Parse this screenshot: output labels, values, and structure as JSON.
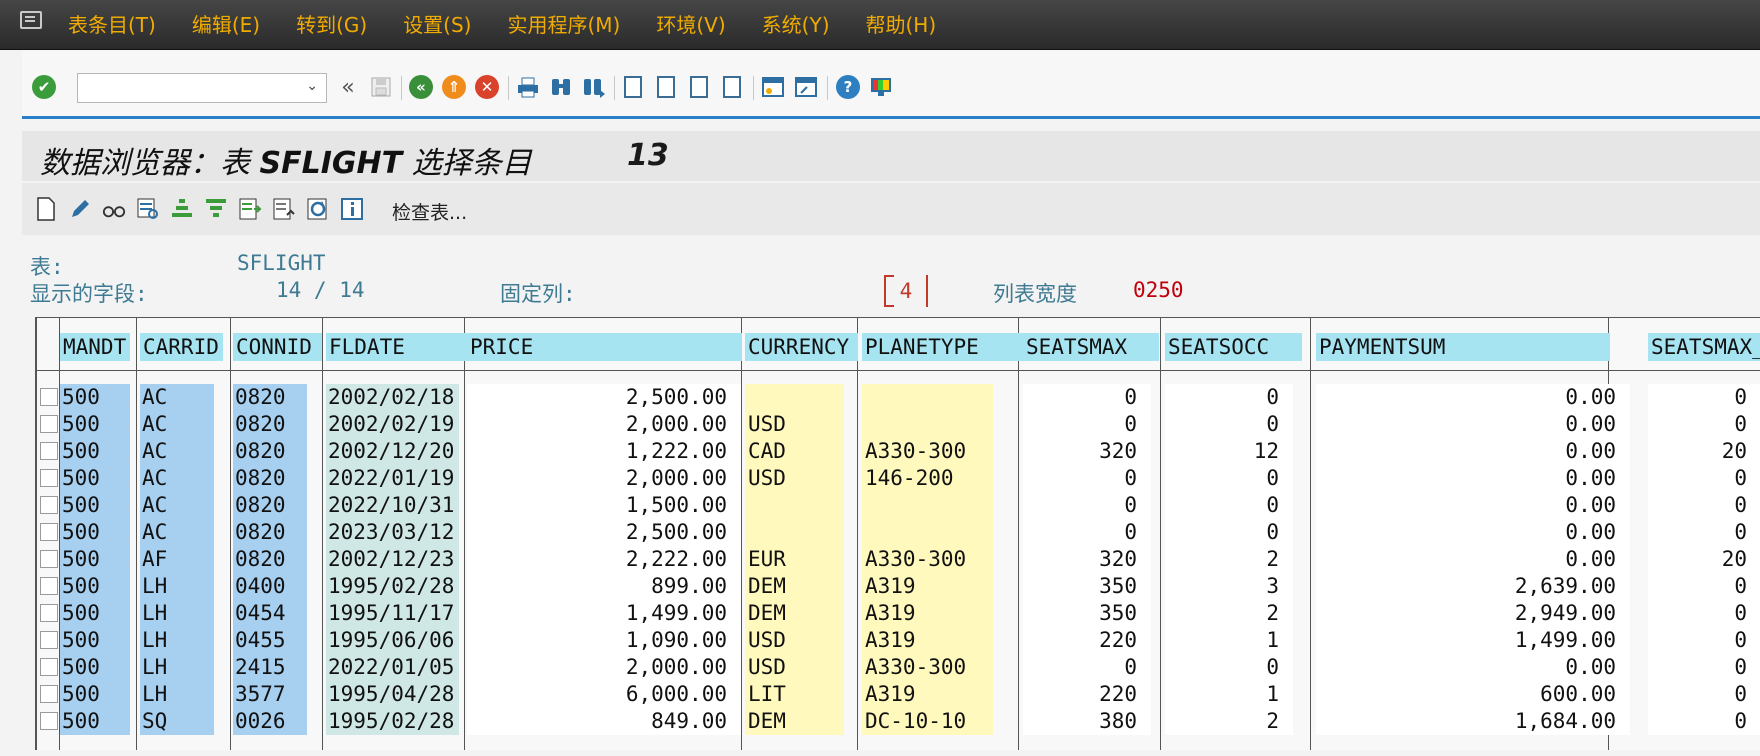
{
  "menu": [
    "表条目(T)",
    "编辑(E)",
    "转到(G)",
    "设置(S)",
    "实用程序(M)",
    "环境(V)",
    "系统(Y)",
    "帮助(H)"
  ],
  "command_field": {
    "value": ""
  },
  "title": {
    "prefix": "数据浏览器：表 ",
    "table": "SFLIGHT",
    "suffix": " 选择条目",
    "count": "13"
  },
  "app_toolbar": {
    "check_table_label": "检查表..."
  },
  "info": {
    "table_label": "表:",
    "table_value": "SFLIGHT",
    "fields_label": "显示的字段:",
    "fields_value": "14 /   14",
    "fixed_label": "固定列:",
    "fixed_value": "4",
    "width_label": "列表宽度",
    "width_value": "0250"
  },
  "columns": [
    "MANDT",
    "CARRID",
    "CONNID",
    "FLDATE",
    "PRICE",
    "CURRENCY",
    "PLANETYPE",
    "SEATSMAX",
    "SEATSOCC",
    "PAYMENTSUM",
    "SEATSMAX_B"
  ],
  "rows": [
    [
      "500",
      "AC",
      "0820",
      "2002/02/18",
      "2,500.00",
      "",
      "",
      "0",
      "0",
      "0.00",
      "0"
    ],
    [
      "500",
      "AC",
      "0820",
      "2002/02/19",
      "2,000.00",
      "USD",
      "",
      "0",
      "0",
      "0.00",
      "0"
    ],
    [
      "500",
      "AC",
      "0820",
      "2002/12/20",
      "1,222.00",
      "CAD",
      "A330-300",
      "320",
      "12",
      "0.00",
      "20"
    ],
    [
      "500",
      "AC",
      "0820",
      "2022/01/19",
      "2,000.00",
      "USD",
      "146-200",
      "0",
      "0",
      "0.00",
      "0"
    ],
    [
      "500",
      "AC",
      "0820",
      "2022/10/31",
      "1,500.00",
      "",
      "",
      "0",
      "0",
      "0.00",
      "0"
    ],
    [
      "500",
      "AC",
      "0820",
      "2023/03/12",
      "2,500.00",
      "",
      "",
      "0",
      "0",
      "0.00",
      "0"
    ],
    [
      "500",
      "AF",
      "0820",
      "2002/12/23",
      "2,222.00",
      "EUR",
      "A330-300",
      "320",
      "2",
      "0.00",
      "20"
    ],
    [
      "500",
      "LH",
      "0400",
      "1995/02/28",
      "899.00",
      "DEM",
      "A319",
      "350",
      "3",
      "2,639.00",
      "0"
    ],
    [
      "500",
      "LH",
      "0454",
      "1995/11/17",
      "1,499.00",
      "DEM",
      "A319",
      "350",
      "2",
      "2,949.00",
      "0"
    ],
    [
      "500",
      "LH",
      "0455",
      "1995/06/06",
      "1,090.00",
      "USD",
      "A319",
      "220",
      "1",
      "1,499.00",
      "0"
    ],
    [
      "500",
      "LH",
      "2415",
      "2022/01/05",
      "2,000.00",
      "USD",
      "A330-300",
      "0",
      "0",
      "0.00",
      "0"
    ],
    [
      "500",
      "LH",
      "3577",
      "1995/04/28",
      "6,000.00",
      "LIT",
      "A319",
      "220",
      "1",
      "600.00",
      "0"
    ],
    [
      "500",
      "SQ",
      "0026",
      "1995/02/28",
      "849.00",
      "DEM",
      "DC-10-10",
      "380",
      "2",
      "1,684.00",
      "0"
    ]
  ],
  "colors": {
    "accent": "#2a7fc9",
    "menu_text": "#f0ab00",
    "header_bg": "#a6e4f2",
    "key_bg": "#a7cff0",
    "currency_bg": "#fff9be",
    "fixed_marker": "#c0392b"
  },
  "icons": [
    "menu-icon",
    "enter-check-icon",
    "back-icon",
    "save-icon",
    "back-green-icon",
    "exit-icon",
    "cancel-icon",
    "print-icon",
    "find-icon",
    "find-next-icon",
    "first-page-icon",
    "prev-page-icon",
    "next-page-icon",
    "last-page-icon",
    "new-session-icon",
    "shortcut-icon",
    "help-icon",
    "customize-layout-icon"
  ]
}
